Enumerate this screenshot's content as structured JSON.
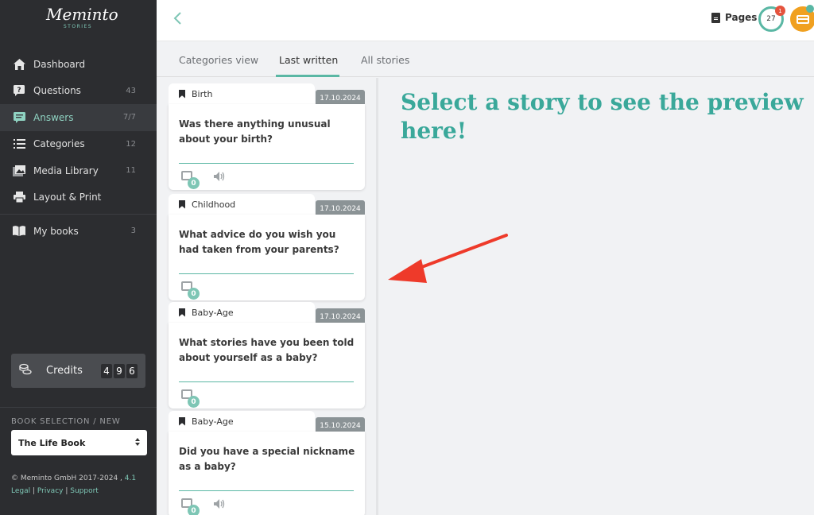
{
  "brand": {
    "name": "Meminto",
    "sub": "STORIES"
  },
  "sidebar": {
    "items": [
      {
        "label": "Dashboard",
        "count": "",
        "icon": "home-icon"
      },
      {
        "label": "Questions",
        "count": "43",
        "icon": "question-icon"
      },
      {
        "label": "Answers",
        "count": "7/7",
        "icon": "answer-icon",
        "active": true
      },
      {
        "label": "Categories",
        "count": "12",
        "icon": "list-icon"
      },
      {
        "label": "Media Library",
        "count": "11",
        "icon": "image-icon"
      },
      {
        "label": "Layout & Print",
        "count": "",
        "icon": "printer-icon"
      }
    ],
    "books": {
      "label": "My books",
      "count": "3",
      "icon": "book-icon"
    },
    "credits": {
      "label": "Credits",
      "digits": [
        "4",
        "9",
        "6"
      ]
    },
    "book_selection": {
      "title": "BOOK SELECTION / NEW",
      "selected": "The Life Book"
    },
    "footer": {
      "copyright": "© Meminto GmbH 2017-2024 ,",
      "version": "4.1",
      "links": [
        "Legal",
        "Privacy",
        "Support"
      ]
    }
  },
  "topbar": {
    "back_icon": "chevron-left-icon",
    "pages_label": "Pages",
    "progress_value": "27",
    "progress_badge": "1"
  },
  "tabs": [
    "Categories view",
    "Last written",
    "All stories"
  ],
  "active_tab": "Last written",
  "cards": [
    {
      "category": "Birth",
      "date": "17.10.2024",
      "question": "Was there anything unusual about your birth?",
      "media_count": "0",
      "audio": true
    },
    {
      "category": "Childhood",
      "date": "17.10.2024",
      "question": "What advice do you wish you had taken from your parents?",
      "media_count": "0",
      "audio": false
    },
    {
      "category": "Baby-Age",
      "date": "17.10.2024",
      "question": "What stories have you been told about yourself as a baby?",
      "media_count": "0",
      "audio": false
    },
    {
      "category": "Baby-Age",
      "date": "15.10.2024",
      "question": "Did you have a special nickname as a baby?",
      "media_count": "0",
      "audio": true
    }
  ],
  "preview": {
    "placeholder": "Select a story to see the preview here!"
  },
  "colors": {
    "accent": "#5ab7a4",
    "sidebar": "#2c2d30",
    "annotation_arrow": "#ee3a2a",
    "cart": "#f0a020"
  }
}
